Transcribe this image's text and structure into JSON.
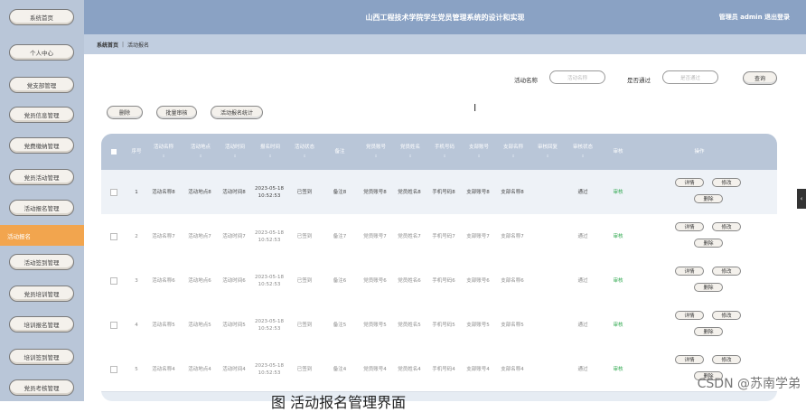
{
  "app": {
    "title": "山西工程技术学院学生党员管理系统的设计和实现",
    "user": "管理员 admin  退出登录"
  },
  "sidebar": {
    "items": [
      {
        "label": "系统首页"
      },
      {
        "label": "个人中心"
      },
      {
        "label": "党支部管理"
      },
      {
        "label": "党员信息管理"
      },
      {
        "label": "党费缴纳管理"
      },
      {
        "label": "党员活动管理"
      },
      {
        "label": "活动报名管理"
      },
      {
        "label": "活动签到管理"
      },
      {
        "label": "党员培训管理"
      },
      {
        "label": "培训报名管理"
      },
      {
        "label": "培训签到管理"
      },
      {
        "label": "党员考核管理"
      }
    ],
    "active_label": "活动报名"
  },
  "breadcrumb": {
    "home": "系统首页",
    "sep": "|",
    "current": "活动报名"
  },
  "search": {
    "name_label": "活动名称",
    "name_placeholder": "活动名称",
    "pass_label": "是否通过",
    "pass_placeholder": "是否通过",
    "query_button": "查询"
  },
  "actions": {
    "delete": "删除",
    "batch_audit": "批量审核",
    "stats": "活动报名统计"
  },
  "table": {
    "headers": {
      "index": "序号",
      "name": "活动名称",
      "place": "活动地点",
      "time": "活动时间",
      "signup_time": "报名时间",
      "status": "活动状态",
      "note": "备注",
      "account": "党员账号",
      "member_name": "党员姓名",
      "phone": "手机号码",
      "branch_account": "支部账号",
      "branch_name": "支部名称",
      "reply": "审核回复",
      "audit_status": "审核状态",
      "audit": "审核",
      "ops": "操作"
    },
    "caret": "⇕",
    "rows": [
      {
        "index": "1",
        "name": "活动名称8",
        "place": "活动地点8",
        "time": "活动时间8",
        "signup": "2023-05-18 10:52:53",
        "status": "已签到",
        "note": "备注8",
        "account": "党员账号8",
        "member": "党员姓名8",
        "phone": "手机号码8",
        "branch_acc": "支部账号8",
        "branch": "支部名称8",
        "reply": "",
        "audit_status": "通过",
        "audit": "审核"
      },
      {
        "index": "2",
        "name": "活动名称7",
        "place": "活动地点7",
        "time": "活动时间7",
        "signup": "2023-05-18 10:52:53",
        "status": "已签到",
        "note": "备注7",
        "account": "党员账号7",
        "member": "党员姓名7",
        "phone": "手机号码7",
        "branch_acc": "支部账号7",
        "branch": "支部名称7",
        "reply": "",
        "audit_status": "通过",
        "audit": "审核"
      },
      {
        "index": "3",
        "name": "活动名称6",
        "place": "活动地点6",
        "time": "活动时间6",
        "signup": "2023-05-18 10:52:53",
        "status": "已签到",
        "note": "备注6",
        "account": "党员账号6",
        "member": "党员姓名6",
        "phone": "手机号码6",
        "branch_acc": "支部账号6",
        "branch": "支部名称6",
        "reply": "",
        "audit_status": "通过",
        "audit": "审核"
      },
      {
        "index": "4",
        "name": "活动名称5",
        "place": "活动地点5",
        "time": "活动时间5",
        "signup": "2023-05-18 10:52:53",
        "status": "已签到",
        "note": "备注5",
        "account": "党员账号5",
        "member": "党员姓名5",
        "phone": "手机号码5",
        "branch_acc": "支部账号5",
        "branch": "支部名称5",
        "reply": "",
        "audit_status": "通过",
        "audit": "审核"
      },
      {
        "index": "5",
        "name": "活动名称4",
        "place": "活动地点4",
        "time": "活动时间4",
        "signup": "2023-05-18 10:52:53",
        "status": "已签到",
        "note": "备注4",
        "account": "党员账号4",
        "member": "党员姓名4",
        "phone": "手机号码4",
        "branch_acc": "支部账号4",
        "branch": "支部名称4",
        "reply": "",
        "audit_status": "通过",
        "audit": "审核"
      }
    ],
    "row_ops": {
      "detail": "详情",
      "edit": "修改",
      "delete": "删除"
    }
  },
  "caption": "图    活动报名管理界面",
  "watermark": "CSDN @苏南学弟",
  "scroll_tab": "‹",
  "cursor": "I"
}
